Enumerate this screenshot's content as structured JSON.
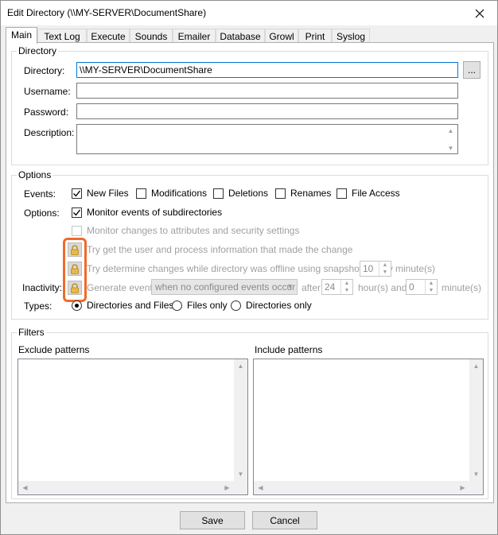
{
  "window": {
    "title": "Edit Directory (\\\\MY-SERVER\\DocumentShare)"
  },
  "tabs": [
    {
      "label": "Main"
    },
    {
      "label": "Text Log"
    },
    {
      "label": "Execute"
    },
    {
      "label": "Sounds"
    },
    {
      "label": "Emailer"
    },
    {
      "label": "Database"
    },
    {
      "label": "Growl"
    },
    {
      "label": "Print"
    },
    {
      "label": "Syslog"
    }
  ],
  "directory_group": {
    "title": "Directory",
    "directory_label": "Directory:",
    "directory_value": "\\\\MY-SERVER\\DocumentShare",
    "browse_label": "...",
    "username_label": "Username:",
    "username_value": "",
    "password_label": "Password:",
    "password_value": "",
    "description_label": "Description:",
    "description_value": ""
  },
  "options_group": {
    "title": "Options",
    "events_label": "Events:",
    "events": {
      "new_files": {
        "label": "New Files",
        "checked": true
      },
      "modifications": {
        "label": "Modifications",
        "checked": false
      },
      "deletions": {
        "label": "Deletions",
        "checked": false
      },
      "renames": {
        "label": "Renames",
        "checked": false
      },
      "file_access": {
        "label": "File Access",
        "checked": false
      }
    },
    "options_label": "Options:",
    "monitor_subdirs": {
      "label": "Monitor events of subdirectories",
      "checked": true
    },
    "monitor_attributes": {
      "label": "Monitor changes to attributes and security settings",
      "checked": false
    },
    "try_user_info": {
      "label": "Try get the user and process information that made the change",
      "checked": false
    },
    "try_snapshots": {
      "label": "Try determine changes while directory was offline using snapshots every",
      "checked": false
    },
    "snapshot_minutes": "10",
    "minutes_unit": "minute(s)",
    "inactivity_label": "Inactivity:",
    "generate_event": {
      "label": "Generate event",
      "checked": false
    },
    "inactivity_condition": "when no configured events occur",
    "after_label": "after",
    "hours_value": "24",
    "hours_unit": "hour(s) and",
    "inactivity_minutes": "0",
    "inactivity_minutes_unit": "minute(s)",
    "types_label": "Types:",
    "types": {
      "dirs_and_files": {
        "label": "Directories and Files",
        "selected": true
      },
      "files_only": {
        "label": "Files only",
        "selected": false
      },
      "dirs_only": {
        "label": "Directories only",
        "selected": false
      }
    }
  },
  "filters_group": {
    "title": "Filters",
    "exclude_label": "Exclude patterns",
    "include_label": "Include patterns"
  },
  "buttons": {
    "save": "Save",
    "cancel": "Cancel"
  },
  "colors": {
    "highlight": "#f06a2a",
    "focus_border": "#0078d7"
  }
}
